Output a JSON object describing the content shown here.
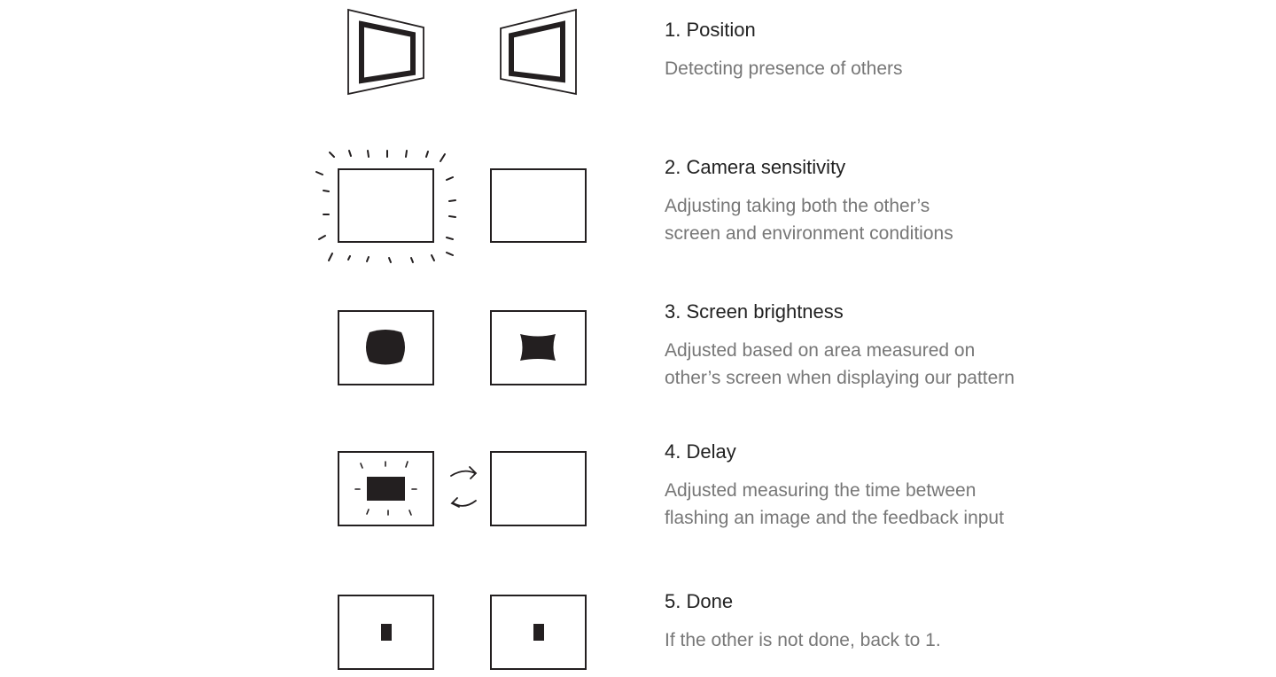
{
  "steps": [
    {
      "title": "1. Position",
      "description": "Detecting presence of others",
      "icon": "tilted-screens-icon"
    },
    {
      "title": "2. Camera sensitivity",
      "description": "Adjusting taking both the other’s\nscreen and environment conditions",
      "icon": "glowing-screen-icon"
    },
    {
      "title": "3. Screen brightness",
      "description": "Adjusted based on area measured on\nother’s screen when displaying our pattern",
      "icon": "brightness-pattern-icon"
    },
    {
      "title": "4. Delay",
      "description": "Adjusted measuring the time between\nflashing an image and the feedback input",
      "icon": "flash-exchange-icon"
    },
    {
      "title": "5. Done",
      "description": "If the other is not done, back to 1.",
      "icon": "done-screens-icon"
    }
  ]
}
